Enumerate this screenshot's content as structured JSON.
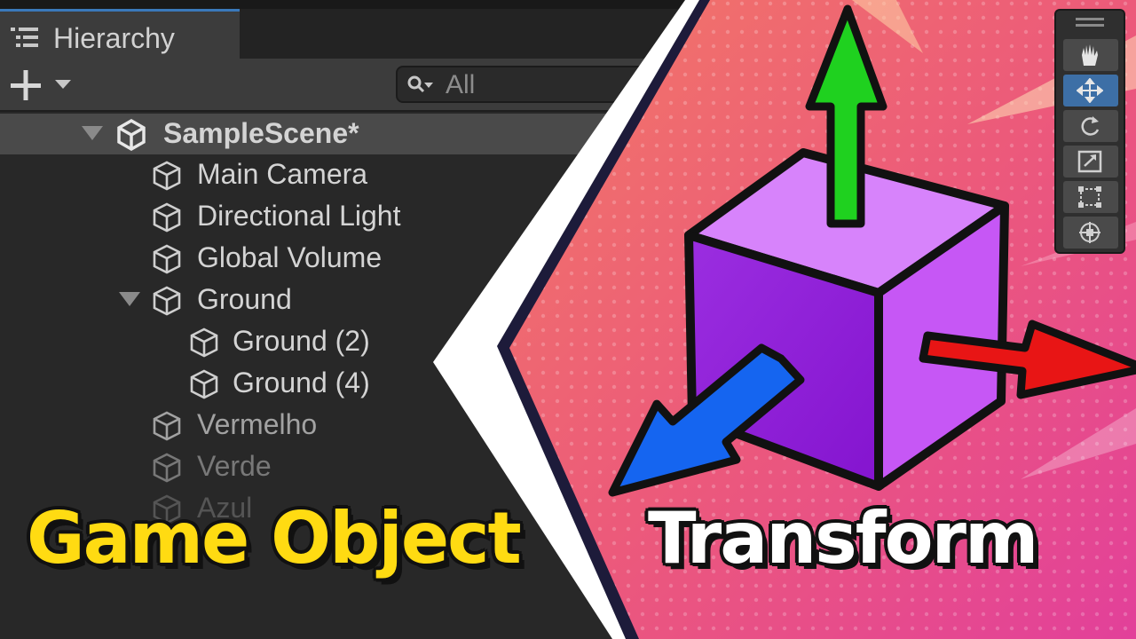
{
  "hierarchy": {
    "tab_label": "Hierarchy",
    "search_placeholder": "All",
    "scene_name": "SampleScene*",
    "items": [
      {
        "label": "Main Camera"
      },
      {
        "label": "Directional Light"
      },
      {
        "label": "Global Volume"
      },
      {
        "label": "Ground"
      },
      {
        "label": "Ground (2)"
      },
      {
        "label": "Ground (4)"
      },
      {
        "label": "Vermelho"
      },
      {
        "label": "Verde"
      },
      {
        "label": "Azul"
      }
    ]
  },
  "tools": {
    "items": [
      "hand-tool",
      "move-tool",
      "rotate-tool",
      "scale-tool",
      "rect-tool",
      "transform-tool"
    ],
    "active": "move-tool"
  },
  "titles": {
    "left": "Game Object",
    "right": "Transform"
  },
  "colors": {
    "accent_blue": "#3d6fa6",
    "title_yellow": "#ffdb12",
    "cube_purple": "#b04ae8",
    "axis_x": "#e81515",
    "axis_y": "#1fd11f",
    "axis_z": "#1565f0",
    "background_pink": "#e8507a"
  }
}
